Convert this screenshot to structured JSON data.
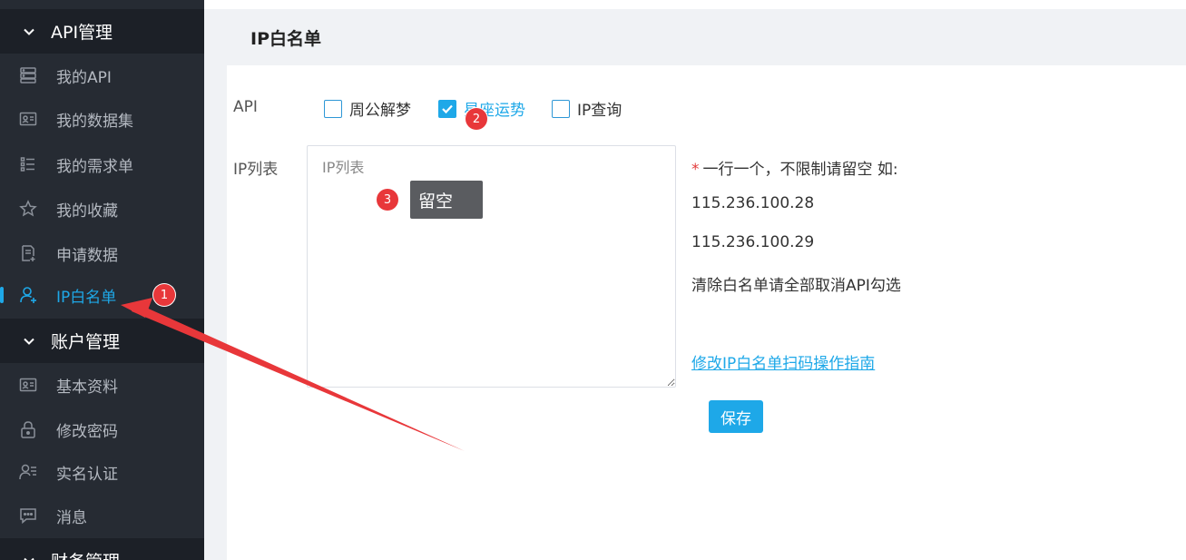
{
  "sidebar": {
    "groups": [
      {
        "label": "API管理"
      },
      {
        "label": "账户管理"
      },
      {
        "label": "财务管理"
      }
    ],
    "items": [
      {
        "label": "我的API",
        "icon": "server-icon"
      },
      {
        "label": "我的数据集",
        "icon": "id-card-icon"
      },
      {
        "label": "我的需求单",
        "icon": "list-icon"
      },
      {
        "label": "我的收藏",
        "icon": "star-icon"
      },
      {
        "label": "申请数据",
        "icon": "document-add-icon"
      },
      {
        "label": "IP白名单",
        "icon": "user-add-icon",
        "active": true
      },
      {
        "label": "基本资料",
        "icon": "id-card-icon"
      },
      {
        "label": "修改密码",
        "icon": "lock-icon"
      },
      {
        "label": "实名认证",
        "icon": "user-list-icon"
      },
      {
        "label": "消息",
        "icon": "message-icon"
      }
    ]
  },
  "page": {
    "title": "IP白名单"
  },
  "form": {
    "api_label": "API",
    "api_options": [
      {
        "label": "周公解梦",
        "checked": false
      },
      {
        "label": "星座运势",
        "checked": true
      },
      {
        "label": "IP查询",
        "checked": false
      }
    ],
    "iplist_label": "IP列表",
    "iplist_placeholder": "IP列表",
    "iplist_value": "",
    "hint_star": "*",
    "hint_title": "一行一个，不限制请留空 如:",
    "hint_ip1": "115.236.100.28",
    "hint_ip2": "115.236.100.29",
    "hint_clear": "清除白名单请全部取消API勾选",
    "guide_link": "修改IP白名单扫码操作指南",
    "save_label": "保存"
  },
  "annotations": {
    "badge1": "1",
    "badge2": "2",
    "badge3": "3",
    "tooltip": "留空"
  },
  "colors": {
    "accent": "#1ea8e8",
    "sidebar_bg": "#262b33",
    "annotation_red": "#e8373a"
  }
}
